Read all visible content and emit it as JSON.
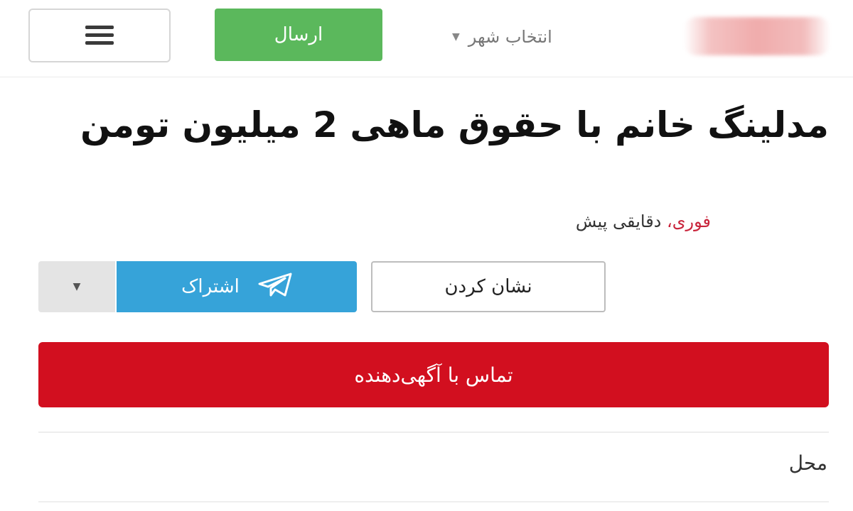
{
  "header": {
    "submit_label": "ارسال",
    "city_placeholder": "انتخاب شهر"
  },
  "ad": {
    "title": "مدلینگ خانم با حقوق ماهی 2 میلیون تومن",
    "urgent_label": "فوری،",
    "time_label": "دقایقی پیش"
  },
  "actions": {
    "mark_label": "نشان کردن",
    "share_label": "اشتراک",
    "contact_label": "تماس با آگهی‌دهنده"
  },
  "details": {
    "location_label": "محل"
  },
  "colors": {
    "green": "#5bb85c",
    "blue": "#36a3d9",
    "red": "#d20f1f"
  },
  "icons": {
    "menu": "hamburger-icon",
    "share": "telegram-icon",
    "caret": "caret-down-icon"
  }
}
